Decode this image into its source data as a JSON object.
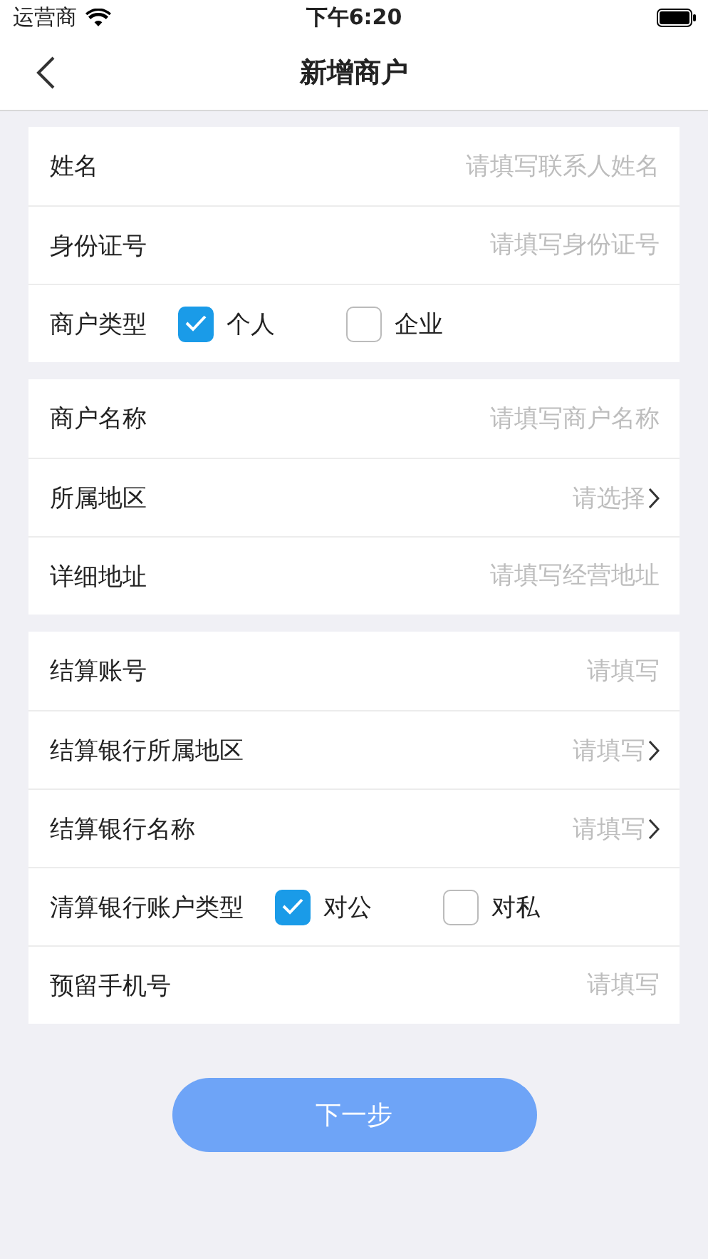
{
  "status_bar": {
    "carrier": "运营商",
    "time": "下午6:20"
  },
  "nav": {
    "title": "新增商户"
  },
  "sections": [
    {
      "rows": [
        {
          "kind": "input",
          "label": "姓名",
          "placeholder": "请填写联系人姓名"
        },
        {
          "kind": "input",
          "label": "身份证号",
          "placeholder": "请填写身份证号"
        },
        {
          "kind": "choice",
          "label": "商户类型",
          "options": [
            {
              "label": "个人",
              "selected": true
            },
            {
              "label": "企业",
              "selected": false
            }
          ]
        }
      ]
    },
    {
      "rows": [
        {
          "kind": "input",
          "label": "商户名称",
          "placeholder": "请填写商户名称"
        },
        {
          "kind": "select",
          "label": "所属地区",
          "placeholder": "请选择"
        },
        {
          "kind": "input",
          "label": "详细地址",
          "placeholder": "请填写经营地址"
        }
      ]
    },
    {
      "rows": [
        {
          "kind": "input",
          "label": "结算账号",
          "placeholder": "请填写"
        },
        {
          "kind": "select",
          "label": "结算银行所属地区",
          "placeholder": "请填写"
        },
        {
          "kind": "select",
          "label": "结算银行名称",
          "placeholder": "请填写"
        },
        {
          "kind": "choice",
          "label": "清算银行账户类型",
          "options": [
            {
              "label": "对公",
              "selected": true
            },
            {
              "label": "对私",
              "selected": false
            }
          ]
        },
        {
          "kind": "input",
          "label": "预留手机号",
          "placeholder": "请填写"
        }
      ]
    }
  ],
  "next_button": "下一步"
}
